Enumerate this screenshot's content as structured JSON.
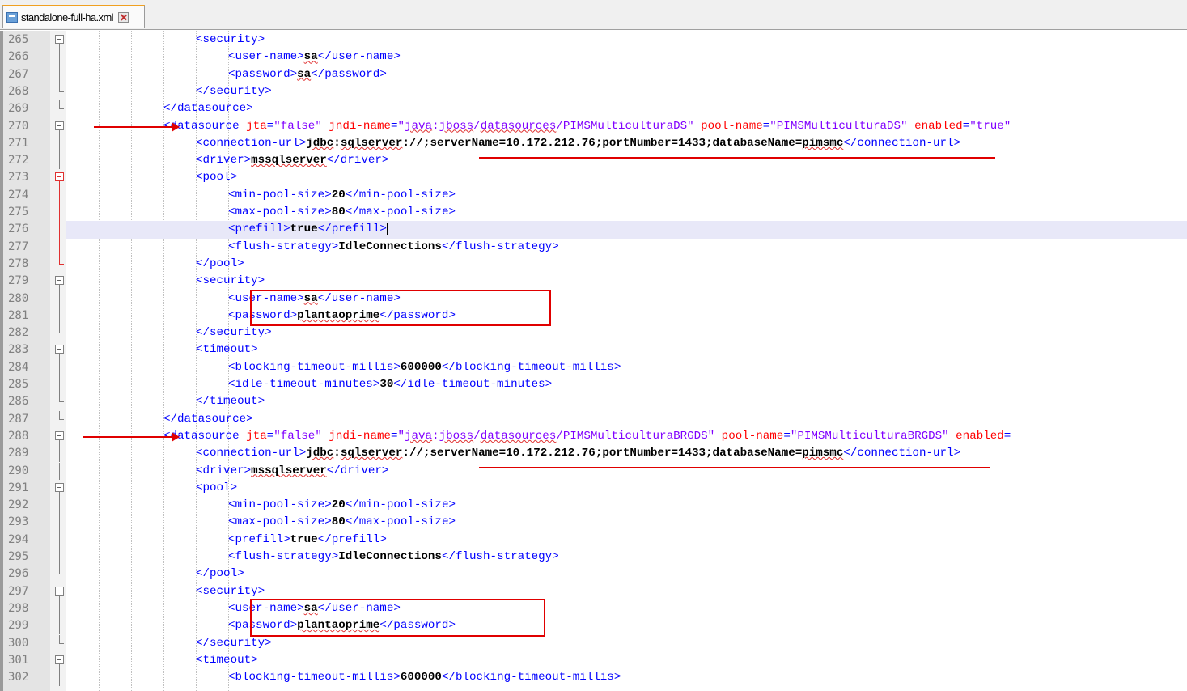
{
  "tab": {
    "filename": "standalone-full-ha.xml"
  },
  "lines": [
    {
      "n": "265",
      "text": "<security>"
    },
    {
      "n": "266",
      "text": "<user-name>sa</user-name>"
    },
    {
      "n": "267",
      "text": "<password>sa</password>"
    },
    {
      "n": "268",
      "text": "</security>"
    },
    {
      "n": "269",
      "text": "</datasource>"
    },
    {
      "n": "270",
      "text": "<datasource jta=\"false\" jndi-name=\"java:jboss/datasources/PIMSMulticulturaDS\" pool-name=\"PIMSMulticulturaDS\" enabled=\"true\""
    },
    {
      "n": "271",
      "text": "<connection-url>jdbc:sqlserver://;serverName=10.172.212.76;portNumber=1433;databaseName=pimsmc</connection-url>"
    },
    {
      "n": "272",
      "text": "<driver>mssqlserver</driver>"
    },
    {
      "n": "273",
      "text": "<pool>"
    },
    {
      "n": "274",
      "text": "<min-pool-size>20</min-pool-size>"
    },
    {
      "n": "275",
      "text": "<max-pool-size>80</max-pool-size>"
    },
    {
      "n": "276",
      "text": "<prefill>true</prefill>"
    },
    {
      "n": "277",
      "text": "<flush-strategy>IdleConnections</flush-strategy>"
    },
    {
      "n": "278",
      "text": "</pool>"
    },
    {
      "n": "279",
      "text": "<security>"
    },
    {
      "n": "280",
      "text": "<user-name>sa</user-name>"
    },
    {
      "n": "281",
      "text": "<password>plantaoprime</password>"
    },
    {
      "n": "282",
      "text": "</security>"
    },
    {
      "n": "283",
      "text": "<timeout>"
    },
    {
      "n": "284",
      "text": "<blocking-timeout-millis>600000</blocking-timeout-millis>"
    },
    {
      "n": "285",
      "text": "<idle-timeout-minutes>30</idle-timeout-minutes>"
    },
    {
      "n": "286",
      "text": "</timeout>"
    },
    {
      "n": "287",
      "text": "</datasource>"
    },
    {
      "n": "288",
      "text": "<datasource jta=\"false\" jndi-name=\"java:jboss/datasources/PIMSMulticulturaBRGDS\" pool-name=\"PIMSMulticulturaBRGDS\" enabled="
    },
    {
      "n": "289",
      "text": "<connection-url>jdbc:sqlserver://;serverName=10.172.212.76;portNumber=1433;databaseName=pimsmc</connection-url>"
    },
    {
      "n": "290",
      "text": "<driver>mssqlserver</driver>"
    },
    {
      "n": "291",
      "text": "<pool>"
    },
    {
      "n": "292",
      "text": "<min-pool-size>20</min-pool-size>"
    },
    {
      "n": "293",
      "text": "<max-pool-size>80</max-pool-size>"
    },
    {
      "n": "294",
      "text": "<prefill>true</prefill>"
    },
    {
      "n": "295",
      "text": "<flush-strategy>IdleConnections</flush-strategy>"
    },
    {
      "n": "296",
      "text": "</pool>"
    },
    {
      "n": "297",
      "text": "<security>"
    },
    {
      "n": "298",
      "text": "<user-name>sa</user-name>"
    },
    {
      "n": "299",
      "text": "<password>plantaoprime</password>"
    },
    {
      "n": "300",
      "text": "</security>"
    },
    {
      "n": "301",
      "text": "<timeout>"
    },
    {
      "n": "302",
      "text": "<blocking-timeout-millis>600000</blocking-timeout-millis>"
    }
  ],
  "colors": {
    "tag": "#0000ff",
    "attribute": "#ff0000",
    "attr_value": "#8000ff",
    "text": "#000000",
    "annotation": "#e00000",
    "current_line": "#e8e8f8"
  }
}
